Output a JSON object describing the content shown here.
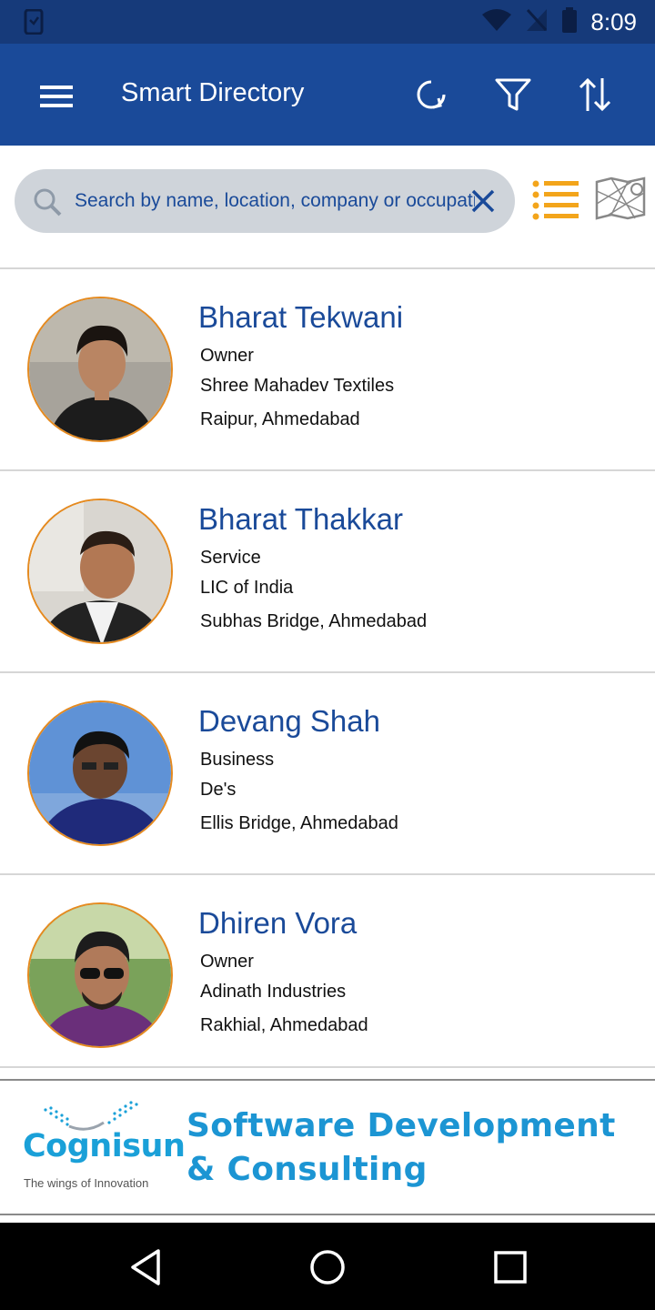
{
  "status_bar": {
    "time": "8:09"
  },
  "app_bar": {
    "title": "Smart Directory",
    "icons": [
      "menu-icon",
      "refresh-icon",
      "filter-icon",
      "sort-icon"
    ]
  },
  "search": {
    "placeholder": "Search by name, location, company or occupation",
    "value": ""
  },
  "contacts": [
    {
      "name": "Bharat Tekwani",
      "role": "Owner",
      "company": "Shree Mahadev Textiles",
      "location": "Raipur, Ahmedabad"
    },
    {
      "name": "Bharat Thakkar",
      "role": "Service",
      "company": "LIC of India",
      "location": "Subhas Bridge, Ahmedabad"
    },
    {
      "name": "Devang Shah",
      "role": "Business",
      "company": "De's",
      "location": "Ellis Bridge, Ahmedabad"
    },
    {
      "name": "Dhiren Vora",
      "role": "Owner",
      "company": "Adinath Industries",
      "location": "Rakhial, Ahmedabad"
    }
  ],
  "banner": {
    "logo_name": "Cognisun",
    "logo_tagline": "The wings of Innovation",
    "tagline_line1": "Software Development",
    "tagline_line2": "& Consulting"
  },
  "colors": {
    "app_bar": "#1a4a99",
    "status_bar": "#163a7a",
    "accent": "#e58a1f",
    "name_text": "#1a4a99",
    "banner_text": "#1c95d3"
  }
}
